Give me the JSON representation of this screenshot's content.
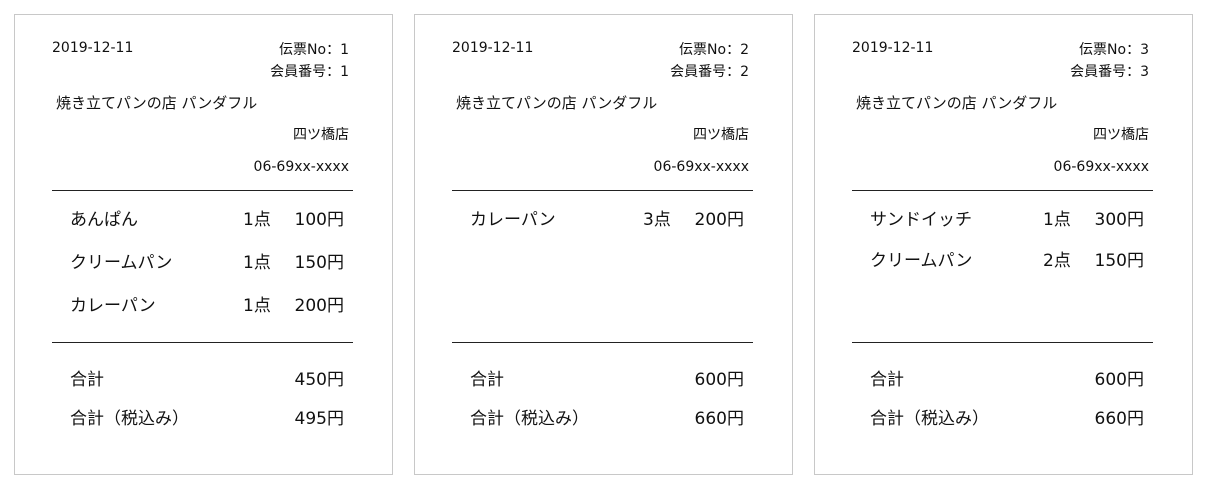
{
  "receipts": [
    {
      "date": "2019-12-11",
      "slip_no": "伝票No：1",
      "member_no": "会員番号：1",
      "shop_name": "焼き立てパンの店 パンダフル",
      "branch": "四ツ橋店",
      "phone": "06-69xx-xxxx",
      "items": [
        {
          "name": "あんぱん",
          "qty": "1点",
          "price": "100円"
        },
        {
          "name": "クリームパン",
          "qty": "1点",
          "price": "150円"
        },
        {
          "name": "カレーパン",
          "qty": "1点",
          "price": "200円"
        }
      ],
      "total_label": "合計",
      "total": "450円",
      "total_tax_label": "合計（税込み）",
      "total_tax": "495円"
    },
    {
      "date": "2019-12-11",
      "slip_no": "伝票No：2",
      "member_no": "会員番号：2",
      "shop_name": "焼き立てパンの店 パンダフル",
      "branch": "四ツ橋店",
      "phone": "06-69xx-xxxx",
      "items": [
        {
          "name": "カレーパン",
          "qty": "3点",
          "price": "200円"
        }
      ],
      "total_label": "合計",
      "total": "600円",
      "total_tax_label": "合計（税込み）",
      "total_tax": "660円"
    },
    {
      "date": "2019-12-11",
      "slip_no": "伝票No：3",
      "member_no": "会員番号：3",
      "shop_name": "焼き立てパンの店 パンダフル",
      "branch": "四ツ橋店",
      "phone": "06-69xx-xxxx",
      "items": [
        {
          "name": "サンドイッチ",
          "qty": "1点",
          "price": "300円"
        },
        {
          "name": "クリームパン",
          "qty": "2点",
          "price": "150円"
        }
      ],
      "total_label": "合計",
      "total": "600円",
      "total_tax_label": "合計（税込み）",
      "total_tax": "660円"
    }
  ]
}
